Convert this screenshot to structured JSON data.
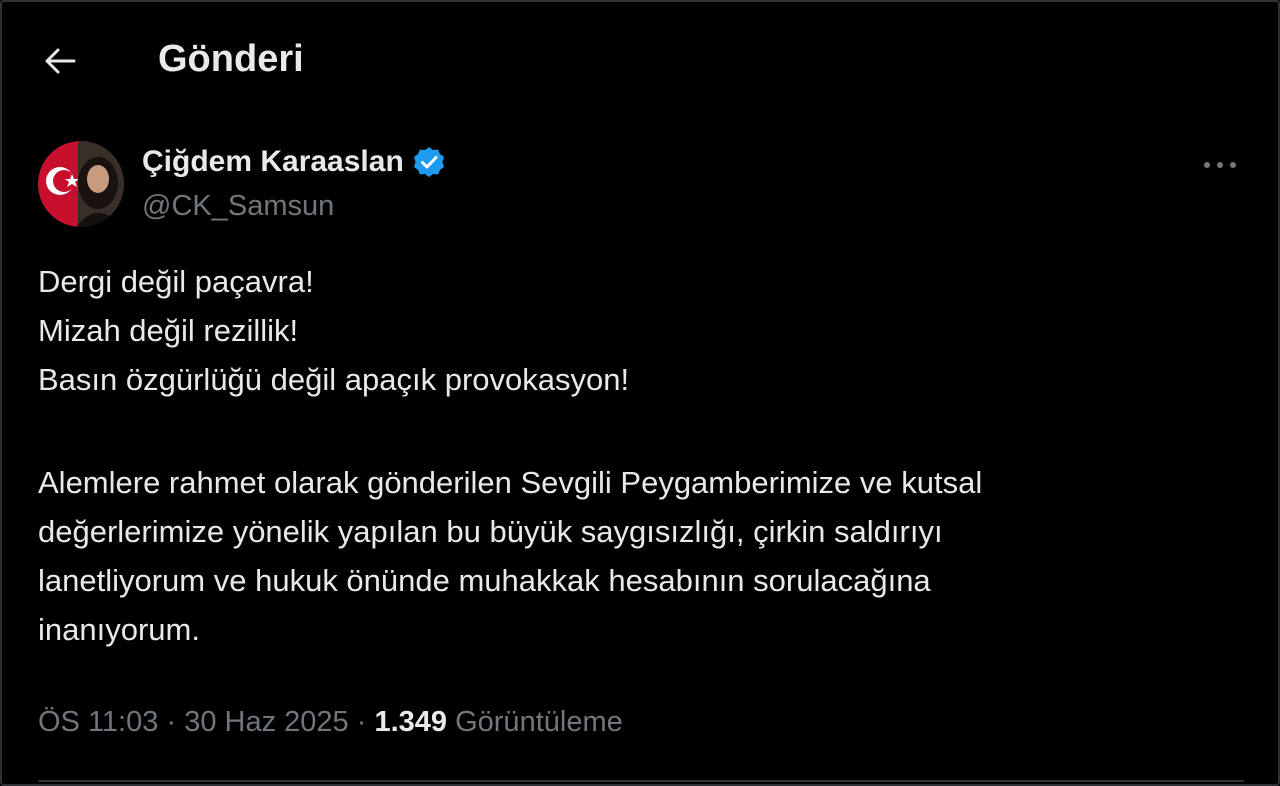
{
  "header": {
    "back_icon": "arrow-left-icon",
    "title": "Gönderi"
  },
  "author": {
    "name": "Çiğdem Karaaslan",
    "handle": "@CK_Samsun",
    "verified": true,
    "avatar_icon": "profile-photo-with-turkish-flag"
  },
  "menu": {
    "icon": "more-horizontal-icon"
  },
  "tweet": {
    "lines": [
      "Dergi değil paçavra!",
      "Mizah değil rezillik!",
      "Basın özgürlüğü değil apaçık provokasyon!",
      "",
      "Alemlere rahmet olarak gönderilen Sevgili Peygamberimize ve kutsal",
      "değerlerimize yönelik yapılan bu büyük saygısızlığı, çirkin saldırıyı",
      "lanetliyorum ve hukuk önünde muhakkak hesabının sorulacağına",
      "inanıyorum."
    ]
  },
  "meta": {
    "time": "ÖS 11:03",
    "separator": "·",
    "date": "30 Haz 2025",
    "views_count": "1.349",
    "views_label": "Görüntüleme"
  },
  "colors": {
    "background": "#000000",
    "text_primary": "#e7e9ea",
    "text_secondary": "#71767b",
    "verified": "#1d9bf0",
    "border": "#2f3336"
  }
}
